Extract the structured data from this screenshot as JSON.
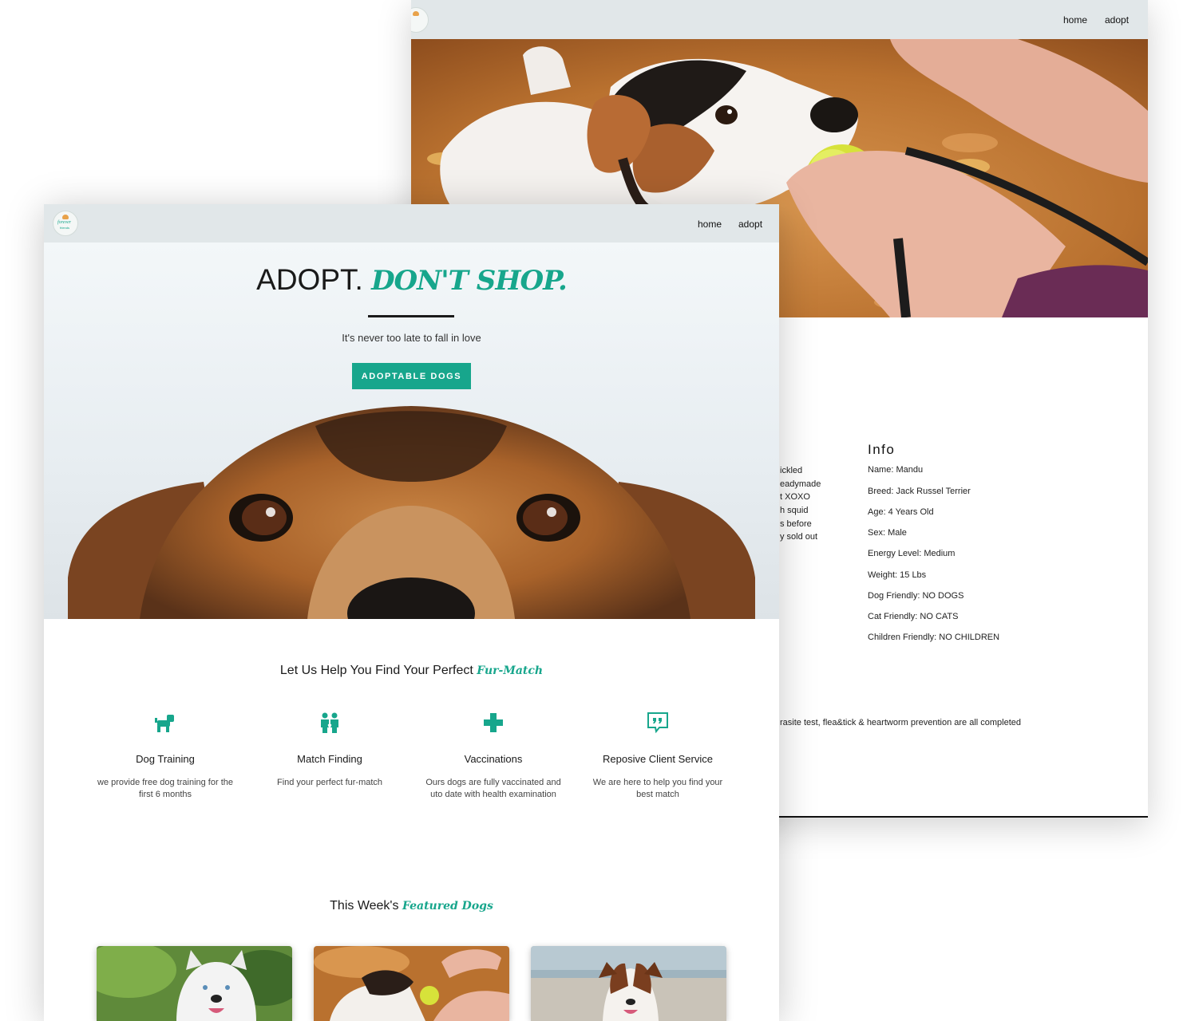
{
  "back_page": {
    "nav": {
      "home": "home",
      "adopt": "adopt"
    },
    "info": {
      "title": "Info",
      "lines": [
        "Name: Mandu",
        "Breed: Jack Russel Terrier",
        "Age: 4 Years Old",
        "Sex: Male",
        "Energy Level: Medium",
        "Weight: 15 Lbs",
        "Dog Friendly: NO DOGS",
        "Cat Friendly: NO CATS",
        "Children Friendly: NO CHILDREN"
      ]
    },
    "description_fragments": [
      "ickled",
      "eadymade",
      "t XOXO",
      "h squid",
      "s before",
      "y sold out"
    ],
    "health_fragment": "rasite test, flea&tick & heartworm prevention are all completed"
  },
  "front_page": {
    "nav": {
      "home": "home",
      "adopt": "adopt"
    },
    "hero": {
      "headline_main": "ADOPT.",
      "headline_accent": "DON'T SHOP.",
      "tagline": "It's never too late to fall in love",
      "cta_label": "ADOPTABLE DOGS"
    },
    "match_section": {
      "title": "Let Us Help You Find Your Perfect",
      "accent": "Fur-Match"
    },
    "features": [
      {
        "icon": "dog-icon",
        "title": "Dog Training",
        "desc": "we provide free dog training for the first 6 months"
      },
      {
        "icon": "match-people-icon",
        "title": "Match Finding",
        "desc": "Find your perfect fur-match"
      },
      {
        "icon": "medical-cross-icon",
        "title": "Vaccinations",
        "desc": "Ours dogs are fully vaccinated and uto date with health examination"
      },
      {
        "icon": "quote-bubble-icon",
        "title": "Reposive Client Service",
        "desc": "We are here to help you find your best match"
      }
    ],
    "featured_section": {
      "title": "This Week's",
      "accent": "Featured Dogs"
    }
  },
  "colors": {
    "accent": "#17a68c",
    "nav_bg": "#e1e7e9"
  }
}
